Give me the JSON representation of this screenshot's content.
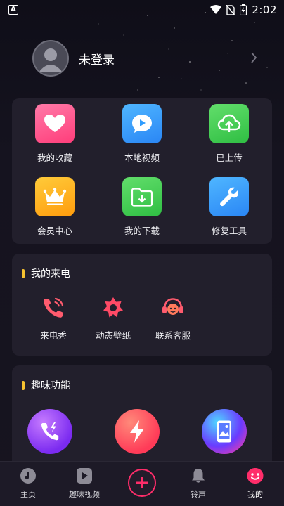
{
  "status_bar": {
    "time": "2:02",
    "left_badge": "A",
    "icons": [
      "wifi-icon",
      "no-sim-icon",
      "battery-charging-icon"
    ]
  },
  "profile": {
    "name": "未登录",
    "avatar_icon": "user-avatar-icon",
    "arrow_icon": "chevron-right-icon"
  },
  "quick_grid": [
    {
      "label": "我的收藏",
      "icon": "heart-icon",
      "color": "#ff4f8a"
    },
    {
      "label": "本地视频",
      "icon": "play-bubble-icon",
      "color": "#2f9dff"
    },
    {
      "label": "已上传",
      "icon": "cloud-upload-icon",
      "color": "#3fce4f"
    },
    {
      "label": "会员中心",
      "icon": "crown-icon",
      "color": "#ffb21c"
    },
    {
      "label": "我的下载",
      "icon": "folder-download-icon",
      "color": "#3fce4f"
    },
    {
      "label": "修复工具",
      "icon": "wrench-icon",
      "color": "#2f9dff"
    }
  ],
  "my_calls": {
    "title": "我的来电",
    "items": [
      {
        "label": "来电秀",
        "icon": "phone-ringing-icon"
      },
      {
        "label": "动态壁纸",
        "icon": "flower-icon"
      },
      {
        "label": "联系客服",
        "icon": "headset-icon"
      }
    ]
  },
  "fun": {
    "title": "趣味功能",
    "items": [
      {
        "icon": "phone-flash-icon"
      },
      {
        "icon": "lightning-icon"
      },
      {
        "icon": "phone-wallpaper-icon"
      }
    ]
  },
  "bottom_nav": {
    "items": [
      {
        "label": "主页",
        "icon": "music-disc-icon"
      },
      {
        "label": "趣味视频",
        "icon": "play-square-icon"
      },
      {
        "label": "",
        "icon": "plus-icon"
      },
      {
        "label": "铃声",
        "icon": "bell-icon"
      },
      {
        "label": "我的",
        "icon": "smile-face-icon",
        "active": true
      }
    ],
    "accent_color": "#ff2d6a"
  }
}
